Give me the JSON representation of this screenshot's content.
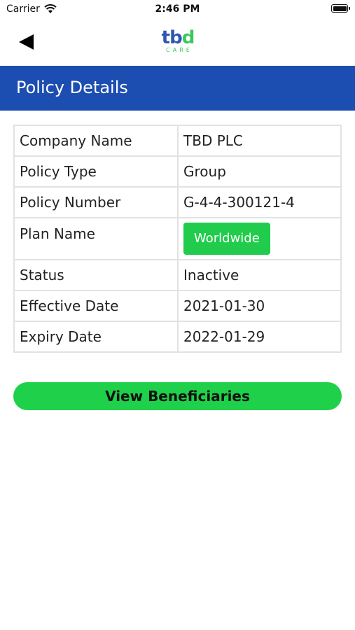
{
  "status_bar": {
    "carrier": "Carrier",
    "time": "2:46 PM"
  },
  "nav": {
    "logo_main_1": "tb",
    "logo_main_2": "d",
    "logo_sub": "CARE"
  },
  "header": {
    "title": "Policy Details"
  },
  "details": [
    {
      "label": "Company Name",
      "value": "TBD PLC"
    },
    {
      "label": "Policy Type",
      "value": "Group"
    },
    {
      "label": "Policy Number",
      "value": "G-4-4-300121-4"
    },
    {
      "label": "Plan Name",
      "value": "Worldwide"
    },
    {
      "label": "Status",
      "value": "Inactive"
    },
    {
      "label": "Effective Date",
      "value": "2021-01-30"
    },
    {
      "label": "Expiry Date",
      "value": "2022-01-29"
    }
  ],
  "actions": {
    "view_beneficiaries": "View Beneficiaries"
  },
  "colors": {
    "header_blue": "#1c4db1",
    "accent_green": "#21cc4c",
    "logo_blue": "#2f56b5"
  }
}
